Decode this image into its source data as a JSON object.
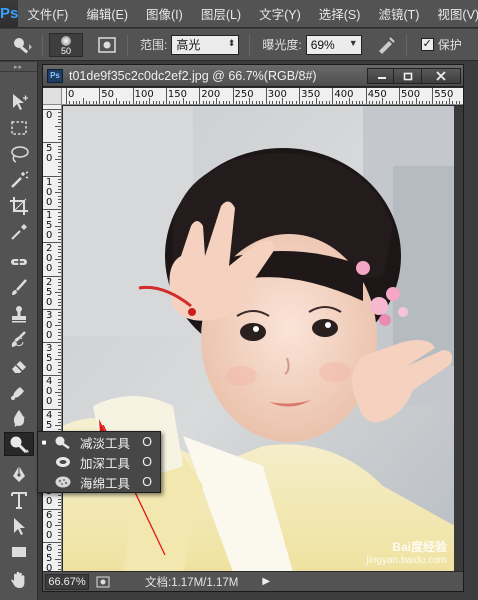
{
  "app": {
    "logo": "Ps",
    "menu": [
      "文件(F)",
      "编辑(E)",
      "图像(I)",
      "图层(L)",
      "文字(Y)",
      "选择(S)",
      "滤镜(T)",
      "视图(V)"
    ]
  },
  "options_bar": {
    "tool_icon": "dodge-tool-icon",
    "brush_size": "50",
    "range_label": "范围:",
    "range_value": "高光",
    "exposure_label": "曝光度:",
    "exposure_value": "69%",
    "protect_label": "保护"
  },
  "document": {
    "badge": "Ps",
    "title": "t01de9f35c2c0dc2ef2.jpg @ 66.7%(RGB/8#)",
    "ruler_top": [
      "0",
      "50",
      "100",
      "150",
      "200",
      "250",
      "300",
      "350",
      "400",
      "450",
      "500",
      "550"
    ],
    "ruler_left": [
      "0",
      "50",
      "100",
      "150",
      "200",
      "250",
      "300",
      "350",
      "400",
      "450",
      "500",
      "550",
      "600",
      "650"
    ],
    "status_zoom": "66.67%",
    "status_info": "文档:1.17M/1.17M",
    "status_arrow": "▶"
  },
  "flyout": {
    "items": [
      {
        "label": "减淡工具",
        "shortcut": "O",
        "selected": true,
        "icon": "dodge-icon"
      },
      {
        "label": "加深工具",
        "shortcut": "O",
        "selected": false,
        "icon": "burn-icon"
      },
      {
        "label": "海绵工具",
        "shortcut": "O",
        "selected": false,
        "icon": "sponge-icon"
      }
    ]
  },
  "watermark": {
    "text": "Bai度经验",
    "url": "jingyan.baidu.com"
  }
}
